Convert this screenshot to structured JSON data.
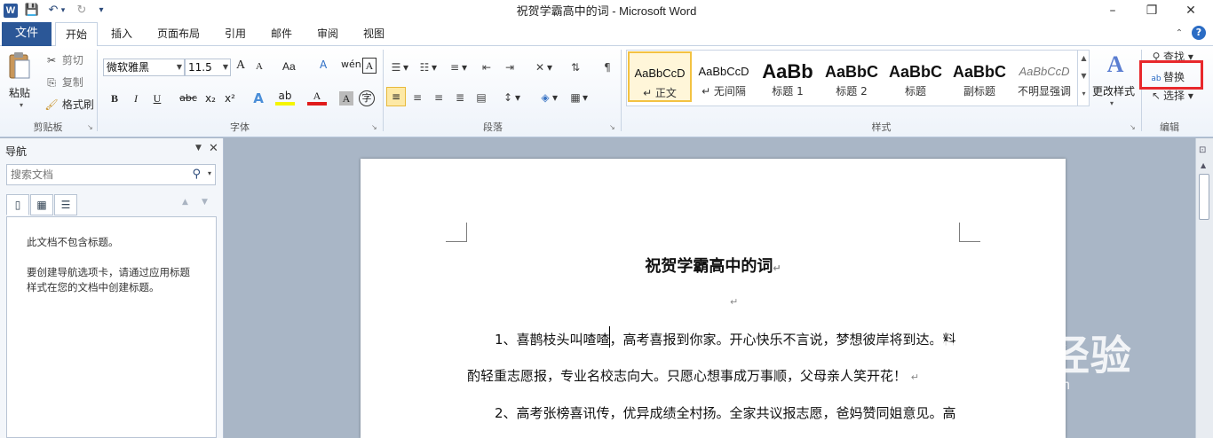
{
  "window": {
    "title": "祝贺学霸高中的词  -  Microsoft Word",
    "min": "–",
    "restore": "❐",
    "close": "✕"
  },
  "quick_access": {
    "save": "💾",
    "undo": "↶",
    "undo_drop": "▾",
    "redo": "↻",
    "customize": "▾"
  },
  "tabs": {
    "file": "文件",
    "items": [
      "开始",
      "插入",
      "页面布局",
      "引用",
      "邮件",
      "审阅",
      "视图"
    ]
  },
  "ribbon": {
    "clipboard": {
      "paste": "粘贴",
      "cut": "剪切",
      "copy": "复制",
      "format_painter": "格式刷",
      "label": "剪贴板"
    },
    "font": {
      "name": "微软雅黑",
      "size": "11.5",
      "label": "字体",
      "bold": "B",
      "italic": "I",
      "underline": "U",
      "strike": "abc",
      "sub": "x₂",
      "sup": "x²",
      "grow": "A",
      "shrink": "A",
      "case": "Aa",
      "clear": "A",
      "phonetic": "A",
      "effects": "A",
      "highlight": "ab",
      "color": "A",
      "border_char": "A",
      "enclose": "字"
    },
    "paragraph": {
      "label": "段落"
    },
    "styles": {
      "label": "样式",
      "items": [
        {
          "sample": "AaBbCcD",
          "name": "↵ 正文"
        },
        {
          "sample": "AaBbCcD",
          "name": "↵ 无间隔"
        },
        {
          "sample": "AaBb",
          "name": "标题 1"
        },
        {
          "sample": "AaBbC",
          "name": "标题 2"
        },
        {
          "sample": "AaBbC",
          "name": "标题"
        },
        {
          "sample": "AaBbC",
          "name": "副标题"
        },
        {
          "sample": "AaBbCcD",
          "name": "不明显强调"
        }
      ],
      "change_styles": "更改样式"
    },
    "editing": {
      "find": "查找",
      "replace": "替换",
      "select": "选择",
      "label": "编辑"
    }
  },
  "nav": {
    "title": "导航",
    "search_placeholder": "搜索文档",
    "line1": "此文档不包含标题。",
    "line2": "要创建导航选项卡，请通过应用标题",
    "line3": "样式在您的文档中创建标题。"
  },
  "document": {
    "title": "祝贺学霸高中的词",
    "p1a": "1、喜鹊枝头叫喳喳，高考喜报到你家。开心快乐不言说，梦想彼岸将到达。料",
    "p1b": "酌轻重志愿报，专业名校志向大。只愿心想事成万事顺，父母亲人笑开花！",
    "p2a": "2、高考张榜喜讯传，优异成绩全村扬。全家共议报志愿，爸妈赞同姐意见。高"
  },
  "watermark": {
    "brand": "Baidu经验",
    "url": "jingyan.baidu.com"
  }
}
